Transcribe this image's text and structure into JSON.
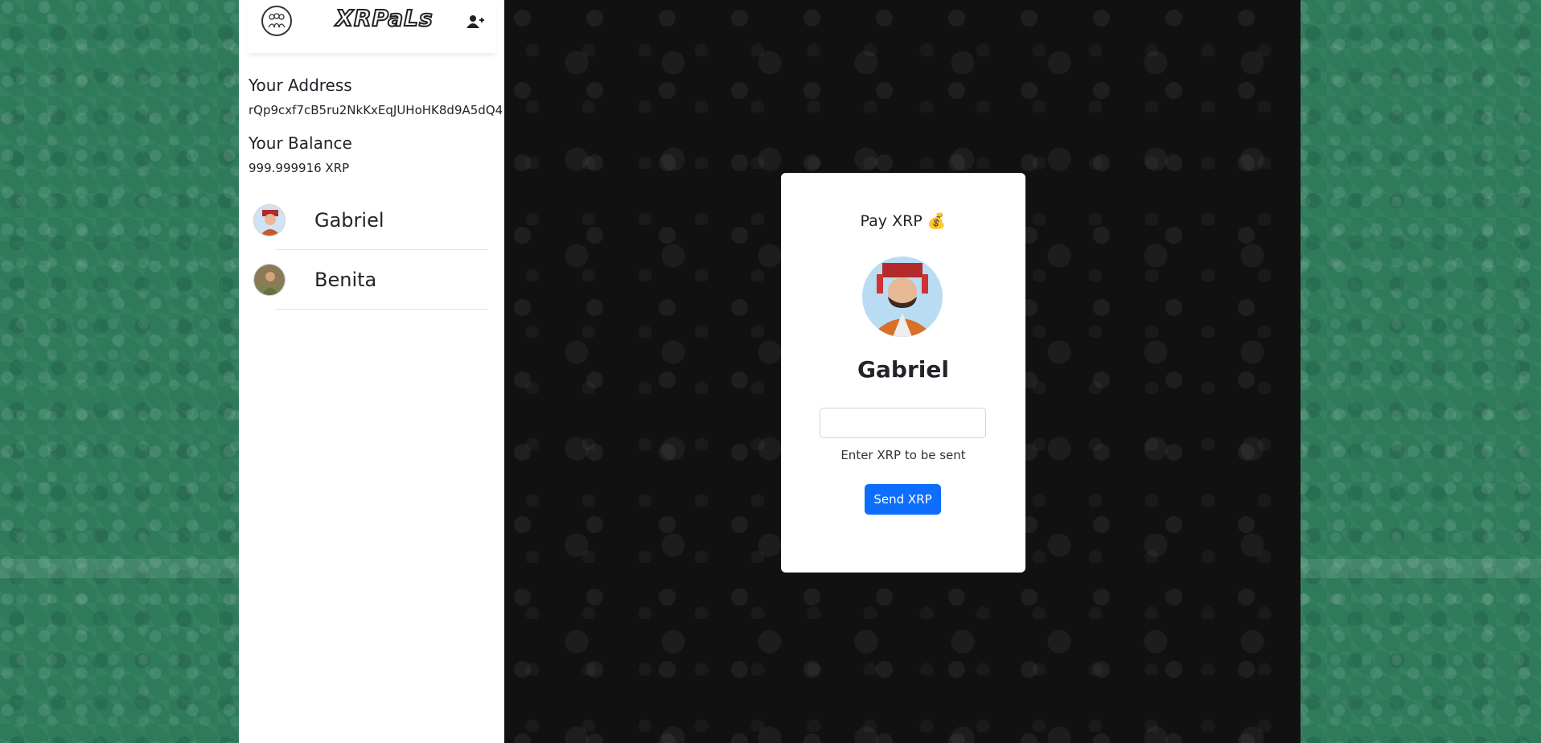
{
  "app": {
    "brand": "XRPaLs"
  },
  "account": {
    "address_label": "Your Address",
    "address": "rQp9cxf7cB5ru2NkKxEqJUHoHK8d9A5dQ4",
    "balance_label": "Your Balance",
    "balance": "999.999916 XRP"
  },
  "contacts": [
    {
      "name": "Gabriel"
    },
    {
      "name": "Benita"
    }
  ],
  "payment": {
    "title": "Pay XRP 💰",
    "recipient": "Gabriel",
    "amount_value": "",
    "amount_help": "Enter XRP to be sent",
    "send_label": "Send XRP"
  },
  "colors": {
    "primary": "#0d6efd",
    "sidebar_bg": "#ffffff",
    "chat_bg": "#111111",
    "outer_bg": "#2e7a5b"
  }
}
